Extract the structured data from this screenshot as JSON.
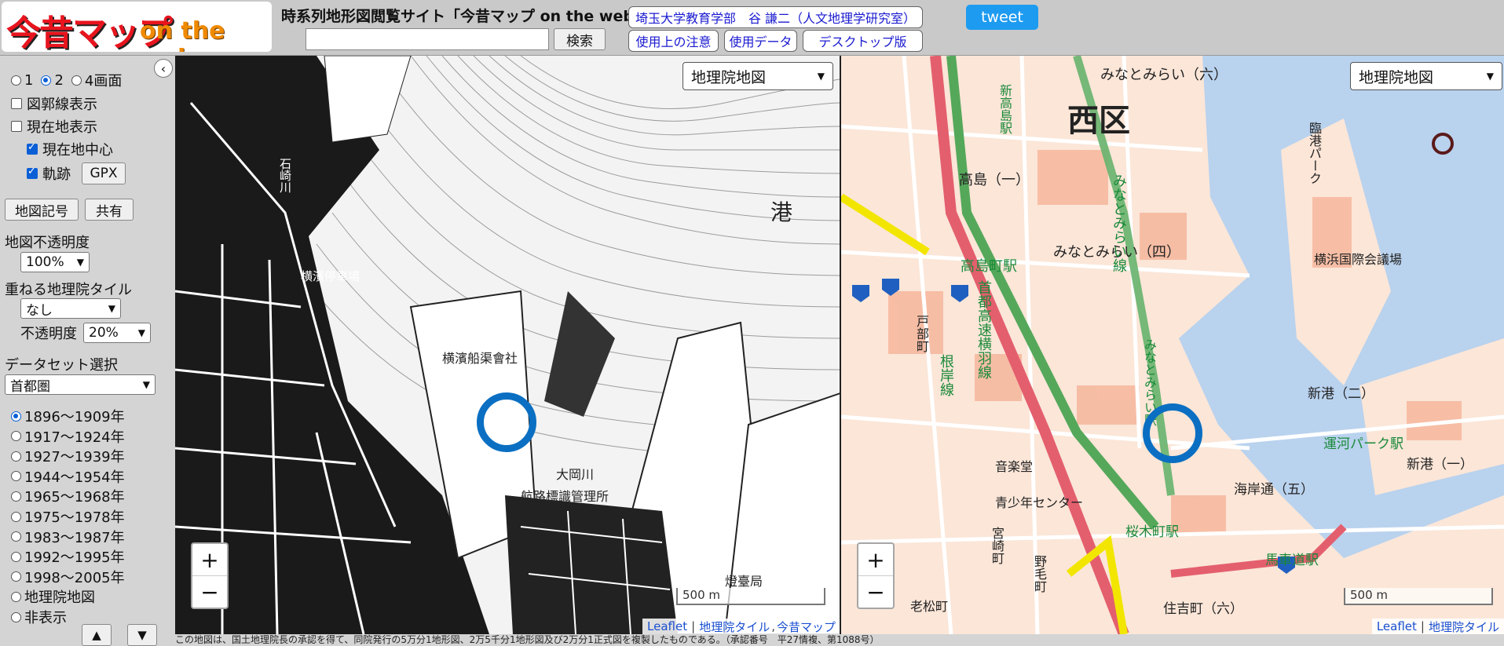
{
  "header": {
    "logo_kanji": "今昔マップ",
    "logo_web": "on the web",
    "site_title": "時系列地形図閲覧サイト「今昔マップ on the web」",
    "search_placeholder": "",
    "search_button": "検索",
    "author_link": "埼玉大学教育学部　谷 謙二（人文地理学研究室）",
    "notes_link": "使用上の注意",
    "data_link": "使用データ",
    "desktop_link": "デスクトップ版",
    "tweet_button": "tweet"
  },
  "sidebar": {
    "screen_options": [
      "1",
      "2",
      "4画面"
    ],
    "screen_selected": "2",
    "show_border": "図郭線表示",
    "show_location": "現在地表示",
    "center_location": "現在地中心",
    "track": "軌跡",
    "gpx_button": "GPX",
    "legend_button": "地図記号",
    "share_button": "共有",
    "opacity_label": "地図不透明度",
    "opacity_value": "100%",
    "overlay_label": "重ねる地理院タイル",
    "overlay_value": "なし",
    "overlay_opacity_label": "不透明度",
    "overlay_opacity_value": "20%",
    "dataset_label": "データセット選択",
    "dataset_value": "首都圏",
    "periods": [
      "1896～1909年",
      "1917～1924年",
      "1927～1939年",
      "1944～1954年",
      "1965～1968年",
      "1975～1978年",
      "1983～1987年",
      "1992～1995年",
      "1998～2005年",
      "地理院地図",
      "非表示"
    ],
    "selected_period": "1896～1909年",
    "up_button": "▲",
    "down_button": "▼",
    "collapse_icon": "‹"
  },
  "map_left": {
    "layer_select": "地理院地図",
    "zoom_in": "+",
    "zoom_out": "−",
    "scale_label": "500 m",
    "attribution": [
      "Leaflet",
      "地理院タイル",
      "今昔マップ"
    ],
    "labels": [
      "港",
      "横濱船渠會社",
      "大岡川",
      "航路標識管理所",
      "燈臺局",
      "石崎川",
      "横濱停車場"
    ]
  },
  "map_right": {
    "layer_select": "地理院地図",
    "zoom_in": "+",
    "zoom_out": "−",
    "scale_label": "500 m",
    "attribution": [
      "Leaflet",
      "地理院タイル"
    ],
    "labels": [
      "西区",
      "みなとみらい（六）",
      "みなとみらい（四）",
      "高島（一）",
      "新高島駅",
      "高島町駅",
      "みなとみらい線",
      "首都高速横羽線",
      "根岸線",
      "横浜国際会議場",
      "新港（二）",
      "運河パーク駅",
      "新港（一）",
      "海岸通（五）",
      "桜木町駅",
      "馬車道駅",
      "住吉町（六）",
      "戸部町",
      "音楽堂",
      "青少年センター",
      "老松町",
      "野毛町",
      "宮崎町",
      "臨港パーク",
      "みなとみらい駅"
    ]
  },
  "footer": {
    "text": "この地図は、国土地理院長の承認を得て、同院発行の5万分1地形図、2万5千分1地形図及び2万分1正式図を複製したものである。（承認番号　平27情複、第1088号）"
  },
  "colors": {
    "marker": "#0a6fc2",
    "tweet": "#1d9bf0",
    "link": "#1a1ad0"
  }
}
